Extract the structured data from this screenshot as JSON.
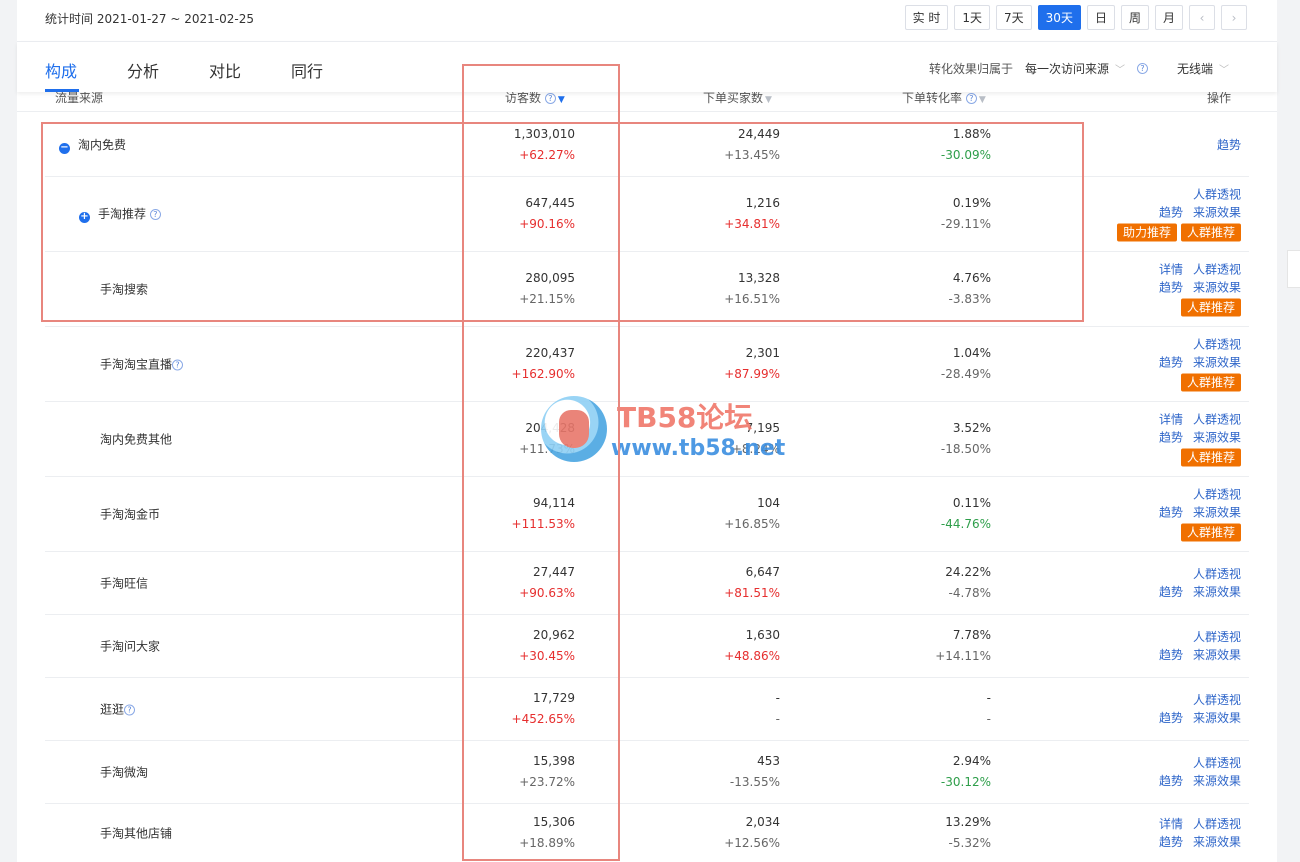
{
  "header": {
    "stat_time": "统计时间 2021-01-27 ~ 2021-02-25",
    "time_tabs": [
      "实 时",
      "1天",
      "7天",
      "30天",
      "日",
      "周",
      "月"
    ],
    "prev_label": "‹",
    "next_label": "›"
  },
  "nav": {
    "tabs": [
      "构成",
      "分析",
      "对比",
      "同行"
    ],
    "attribution_label": "转化效果归属于",
    "attribution_value": "每一次访问来源",
    "device_value": "无线端"
  },
  "table": {
    "columns": [
      "流量来源",
      "访客数",
      "下单买家数",
      "下单转化率",
      "操作"
    ],
    "rows": [
      {
        "source": "淘内免费",
        "visitors": "1,303,010",
        "visitors_change": "+62.27%",
        "buyers": "24,449",
        "buyers_change": "+13.45%",
        "rate": "1.88%",
        "rate_change": "-30.09%",
        "ops_line1": [],
        "ops_line2": [
          "趋势"
        ],
        "badges": []
      },
      {
        "source": "手淘推荐",
        "visitors": "647,445",
        "visitors_change": "+90.16%",
        "buyers": "1,216",
        "buyers_change": "+34.81%",
        "rate": "0.19%",
        "rate_change": "-29.11%",
        "ops_line1": [
          "人群透视"
        ],
        "ops_line2": [
          "趋势",
          "来源效果"
        ],
        "badges": [
          "助力推荐",
          "人群推荐"
        ]
      },
      {
        "source": "手淘搜索",
        "visitors": "280,095",
        "visitors_change": "+21.15%",
        "buyers": "13,328",
        "buyers_change": "+16.51%",
        "rate": "4.76%",
        "rate_change": "-3.83%",
        "ops_line1": [
          "详情",
          "人群透视"
        ],
        "ops_line2": [
          "趋势",
          "来源效果"
        ],
        "badges": [
          "人群推荐"
        ]
      },
      {
        "source": "手淘淘宝直播",
        "visitors": "220,437",
        "visitors_change": "+162.90%",
        "buyers": "2,301",
        "buyers_change": "+87.99%",
        "rate": "1.04%",
        "rate_change": "-28.49%",
        "ops_line1": [
          "人群透视"
        ],
        "ops_line2": [
          "趋势",
          "来源效果"
        ],
        "badges": [
          "人群推荐"
        ]
      },
      {
        "source": "淘内免费其他",
        "visitors": "204,428",
        "visitors_change": "+11.73%",
        "buyers": "7,195",
        "buyers_change": "+8.24%",
        "rate": "3.52%",
        "rate_change": "-18.50%",
        "ops_line1": [
          "详情",
          "人群透视"
        ],
        "ops_line2": [
          "趋势",
          "来源效果"
        ],
        "badges": [
          "人群推荐"
        ]
      },
      {
        "source": "手淘淘金币",
        "visitors": "94,114",
        "visitors_change": "+111.53%",
        "buyers": "104",
        "buyers_change": "+16.85%",
        "rate": "0.11%",
        "rate_change": "-44.76%",
        "ops_line1": [
          "人群透视"
        ],
        "ops_line2": [
          "趋势",
          "来源效果"
        ],
        "badges": [
          "人群推荐"
        ]
      },
      {
        "source": "手淘旺信",
        "visitors": "27,447",
        "visitors_change": "+90.63%",
        "buyers": "6,647",
        "buyers_change": "+81.51%",
        "rate": "24.22%",
        "rate_change": "-4.78%",
        "ops_line1": [
          "人群透视"
        ],
        "ops_line2": [
          "趋势",
          "来源效果"
        ],
        "badges": []
      },
      {
        "source": "手淘问大家",
        "visitors": "20,962",
        "visitors_change": "+30.45%",
        "buyers": "1,630",
        "buyers_change": "+48.86%",
        "rate": "7.78%",
        "rate_change": "+14.11%",
        "ops_line1": [
          "人群透视"
        ],
        "ops_line2": [
          "趋势",
          "来源效果"
        ],
        "badges": []
      },
      {
        "source": "逛逛",
        "visitors": "17,729",
        "visitors_change": "+452.65%",
        "buyers": "-",
        "buyers_change": "-",
        "rate": "-",
        "rate_change": "-",
        "ops_line1": [
          "人群透视"
        ],
        "ops_line2": [
          "趋势",
          "来源效果"
        ],
        "badges": []
      },
      {
        "source": "手淘微淘",
        "visitors": "15,398",
        "visitors_change": "+23.72%",
        "buyers": "453",
        "buyers_change": "-13.55%",
        "rate": "2.94%",
        "rate_change": "-30.12%",
        "ops_line1": [
          "人群透视"
        ],
        "ops_line2": [
          "趋势",
          "来源效果"
        ],
        "badges": []
      },
      {
        "source": "手淘其他店铺",
        "visitors": "15,306",
        "visitors_change": "+18.89%",
        "buyers": "2,034",
        "buyers_change": "+12.56%",
        "rate": "13.29%",
        "rate_change": "-5.32%",
        "ops_line1": [
          "详情",
          "人群透视"
        ],
        "ops_line2": [
          "趋势",
          "来源效果"
        ],
        "badges": []
      }
    ]
  },
  "watermark": {
    "title": "TB58论坛",
    "url": "www.tb58.net"
  },
  "colors": {
    "accent": "#1f6fec",
    "increase": "#e62e2e",
    "decrease_green": "#2e9e4a",
    "badge": "#f07000",
    "highlight": "#e8867e"
  }
}
